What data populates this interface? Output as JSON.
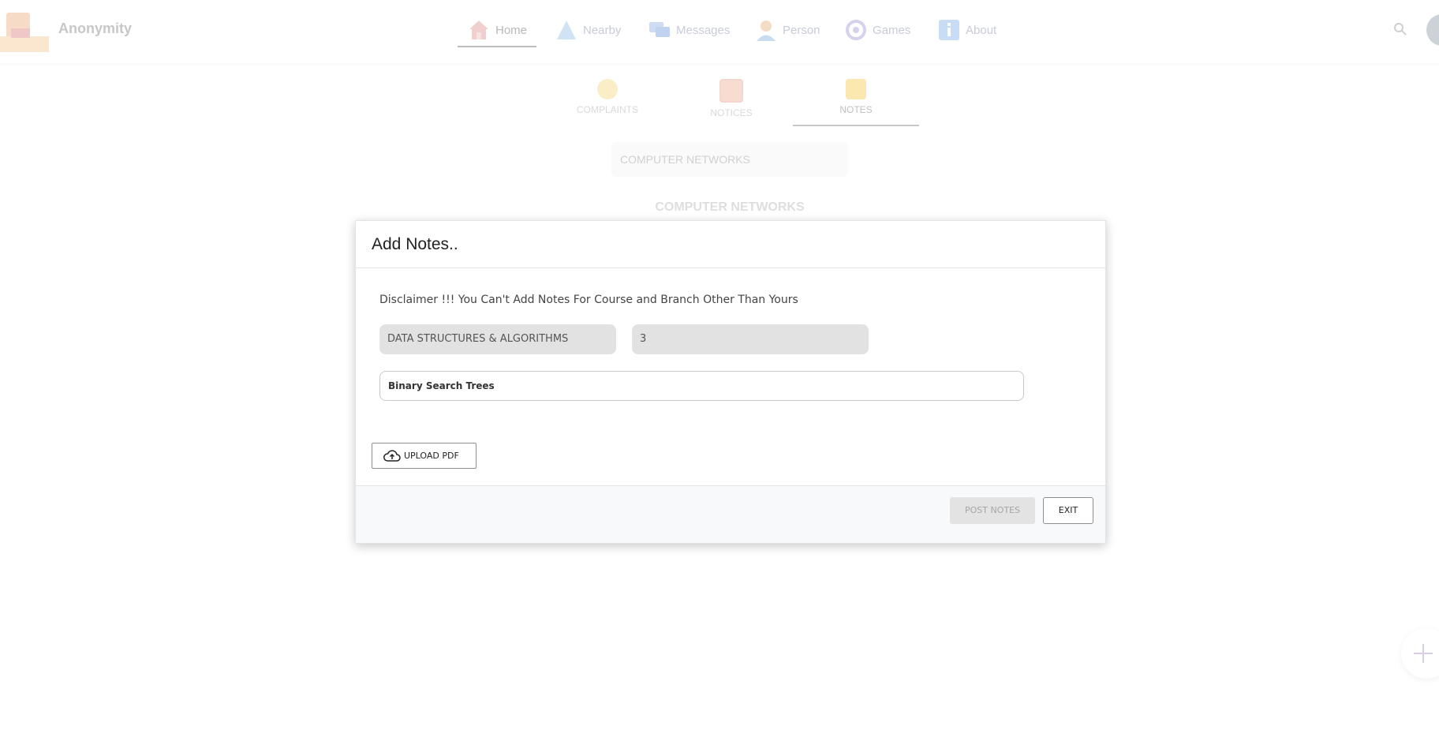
{
  "app": {
    "brand": "Anonymity"
  },
  "nav": {
    "items": [
      {
        "label": "Home",
        "icon": "home-icon"
      },
      {
        "label": "Nearby",
        "icon": "nearby-icon"
      },
      {
        "label": "Messages",
        "icon": "messages-icon"
      },
      {
        "label": "Person",
        "icon": "person-icon"
      },
      {
        "label": "Games",
        "icon": "games-icon"
      },
      {
        "label": "About",
        "icon": "info-icon"
      }
    ],
    "active": "Home"
  },
  "subtabs": {
    "items": [
      {
        "label": "COMPLAINTS",
        "icon": "complaints-icon"
      },
      {
        "label": "NOTICES",
        "icon": "notices-icon"
      },
      {
        "label": "NOTES",
        "icon": "notes-icon"
      }
    ],
    "active": "NOTES"
  },
  "background": {
    "subject_select": "COMPUTER NETWORKS",
    "heading": "COMPUTER NETWORKS"
  },
  "modal": {
    "title": "Add Notes..",
    "disclaimer": "Disclaimer !!! You Can't Add Notes For Course and Branch Other Than Yours",
    "subject_value": "DATA STRUCTURES & ALGORITHMS",
    "unit_value": "3",
    "topic_value": "Binary Search Trees",
    "upload_label": "UPLOAD PDF",
    "post_label": "POST NOTES",
    "exit_label": "EXIT"
  },
  "colors": {
    "modal_footer": "#f8f9fa",
    "disabled_button": "#e3e3e3",
    "field_bg": "#e2e2e2"
  }
}
